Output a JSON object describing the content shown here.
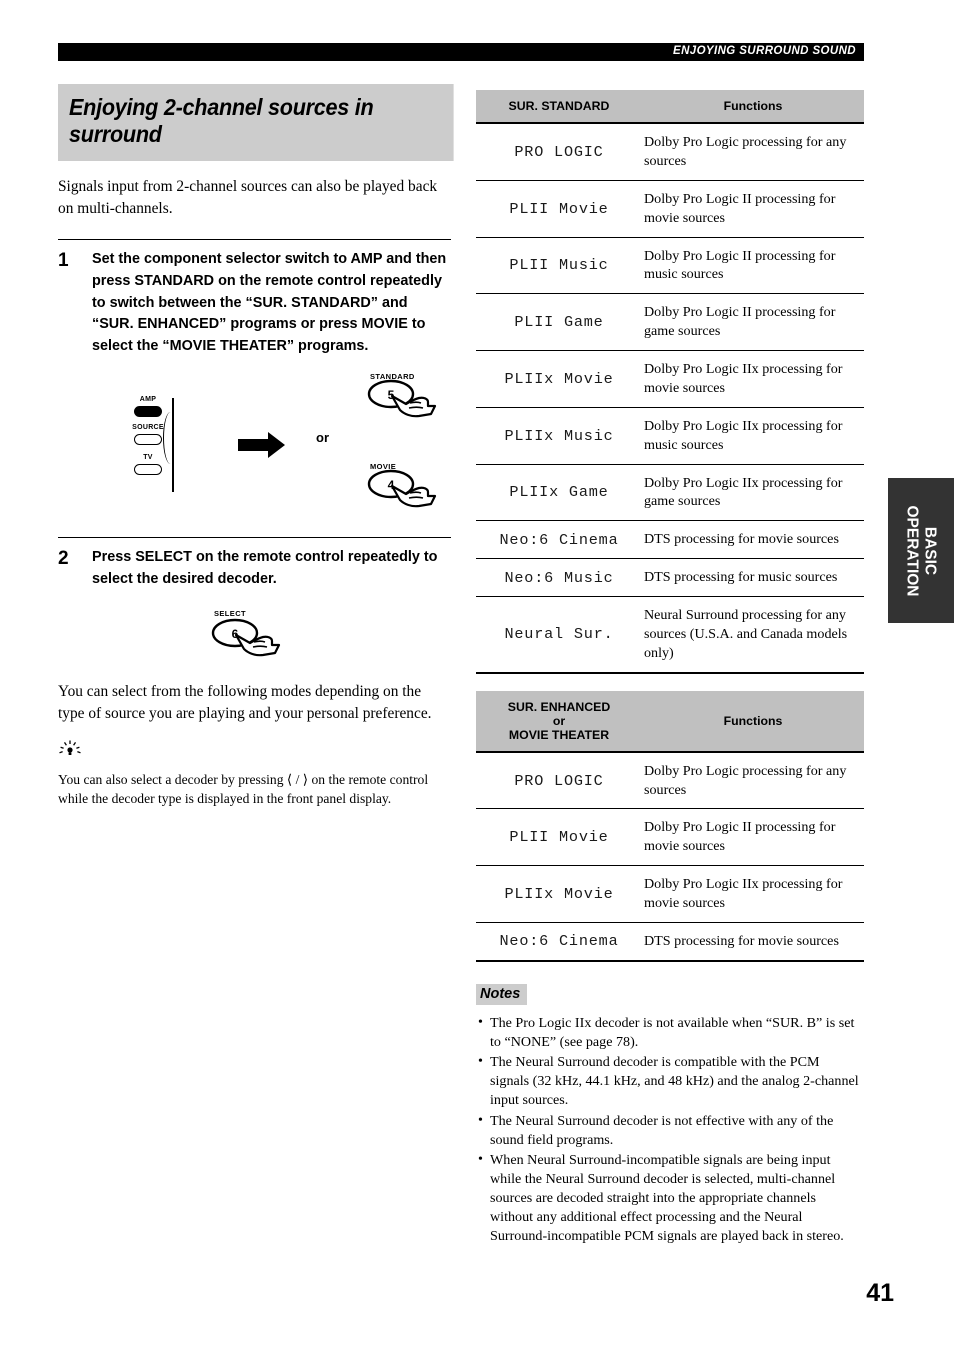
{
  "header": {
    "running_head": "ENJOYING SURROUND SOUND"
  },
  "page": {
    "number": "41",
    "side_tab_line1": "BASIC",
    "side_tab_line2": "OPERATION"
  },
  "section": {
    "title": "Enjoying 2-channel sources in surround",
    "intro": "Signals input from 2-channel sources can also be played back on multi-channels."
  },
  "steps": [
    {
      "number": "1",
      "text": "Set the component selector switch to AMP and then press STANDARD on the remote control repeatedly to switch between the “SUR. STANDARD” and “SUR. ENHANCED” programs or press MOVIE to select the “MOVIE THEATER” programs."
    },
    {
      "number": "2",
      "text": "Press SELECT on the remote control repeatedly to select the desired decoder."
    }
  ],
  "figure1": {
    "selector_labels": [
      "AMP",
      "SOURCE",
      "TV"
    ],
    "selected": "AMP",
    "or_label": "or",
    "button_standard": {
      "name": "STANDARD",
      "key_number": "5"
    },
    "button_movie": {
      "name": "MOVIE",
      "key_number": "4"
    }
  },
  "figure2": {
    "button_select": {
      "name": "SELECT",
      "key_number": "6"
    }
  },
  "body": {
    "paragraph": "You can select from the following modes depending on the type of source you are playing and your personal preference.",
    "tip_text": "You can also select a decoder by pressing ⟨ / ⟩ on the remote control while the decoder type is displayed in the front panel display."
  },
  "table_standard": {
    "header_mode": "SUR. STANDARD",
    "header_functions": "Functions",
    "rows": [
      {
        "mode": "PRO LOGIC",
        "function": "Dolby Pro Logic processing for any sources"
      },
      {
        "mode": "PLII Movie",
        "function": "Dolby Pro Logic II processing for movie sources"
      },
      {
        "mode": "PLII Music",
        "function": "Dolby Pro Logic II processing for music sources"
      },
      {
        "mode": "PLII Game",
        "function": "Dolby Pro Logic II processing for game sources"
      },
      {
        "mode": "PLIIx Movie",
        "function": "Dolby Pro Logic IIx processing for movie sources"
      },
      {
        "mode": "PLIIx Music",
        "function": "Dolby Pro Logic IIx processing for music sources"
      },
      {
        "mode": "PLIIx Game",
        "function": "Dolby Pro Logic IIx processing for game sources"
      },
      {
        "mode": "Neo:6 Cinema",
        "function": "DTS processing for movie sources"
      },
      {
        "mode": "Neo:6 Music",
        "function": "DTS processing for music sources"
      },
      {
        "mode": "Neural Sur.",
        "function": "Neural Surround processing for any sources (U.S.A. and Canada models only)"
      }
    ]
  },
  "table_enhanced": {
    "header_mode_line1": "SUR. ENHANCED",
    "header_mode_line2": "or",
    "header_mode_line3": "MOVIE THEATER",
    "header_functions": "Functions",
    "rows": [
      {
        "mode": "PRO LOGIC",
        "function": "Dolby Pro Logic processing for any sources"
      },
      {
        "mode": "PLII Movie",
        "function": "Dolby Pro Logic II processing for movie sources"
      },
      {
        "mode": "PLIIx Movie",
        "function": "Dolby Pro Logic IIx processing for movie sources"
      },
      {
        "mode": "Neo:6 Cinema",
        "function": "DTS processing for movie sources"
      }
    ]
  },
  "notes": {
    "heading": "Notes",
    "items": [
      "The Pro Logic IIx decoder is not available when “SUR. B” is set to “NONE” (see page 78).",
      "The Neural Surround decoder is compatible with the PCM signals (32 kHz, 44.1 kHz, and 48 kHz) and the analog 2-channel input sources.",
      "The Neural Surround decoder is not effective with any of the sound field programs.",
      "When Neural Surround-incompatible signals are being input while the Neural Surround decoder is selected, multi-channel sources are decoded straight into the appropriate channels without any additional effect processing and the Neural Surround-incompatible PCM signals are played back in stereo."
    ]
  },
  "colors": {
    "header_bar": "#000000",
    "title_background": "#cccccc",
    "table_header_background": "#c0c0c0",
    "side_tab_background": "#333333"
  }
}
